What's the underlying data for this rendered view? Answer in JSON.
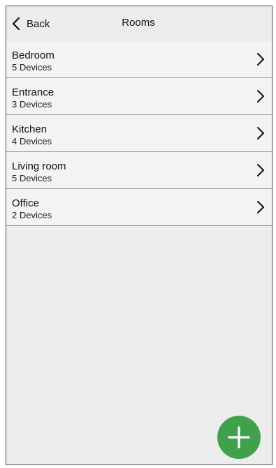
{
  "header": {
    "back_label": "Back",
    "title": "Rooms"
  },
  "rooms": [
    {
      "name": "Bedroom",
      "devices": "5 Devices"
    },
    {
      "name": "Entrance",
      "devices": "3 Devices"
    },
    {
      "name": "Kitchen",
      "devices": "4 Devices"
    },
    {
      "name": "Living room",
      "devices": "5 Devices"
    },
    {
      "name": "Office",
      "devices": "2 Devices"
    }
  ],
  "icons": {
    "back": "chevron-left-icon",
    "row": "chevron-right-icon",
    "add": "plus-icon"
  },
  "colors": {
    "background": "#ececec",
    "row_background": "#f3f3f3",
    "accent": "#3fa14c"
  }
}
